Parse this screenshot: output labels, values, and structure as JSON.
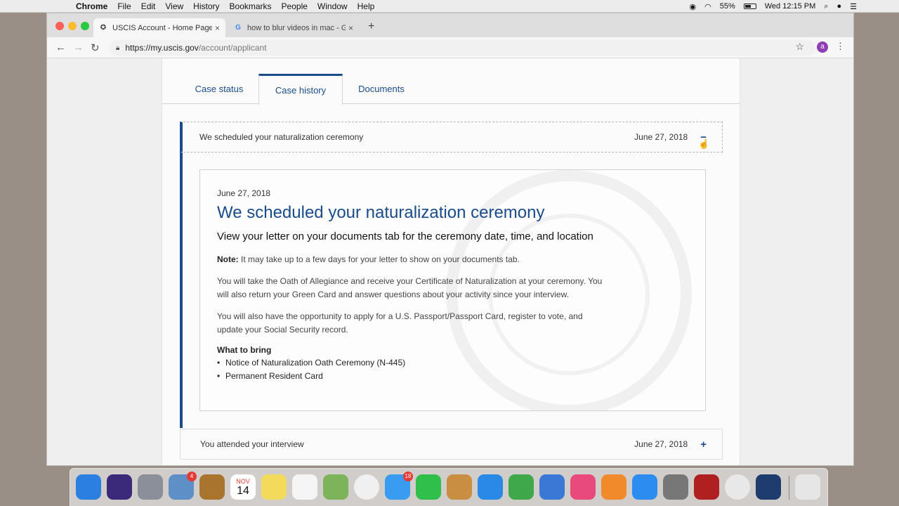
{
  "menubar": {
    "app_name": "Chrome",
    "items": [
      "File",
      "Edit",
      "View",
      "History",
      "Bookmarks",
      "People",
      "Window",
      "Help"
    ],
    "battery": "55%",
    "clock": "Wed 12:15 PM"
  },
  "browser": {
    "tabs": [
      {
        "title": "USCIS Account - Home Page",
        "close": "×"
      },
      {
        "title": "how to blur videos in mac - Go",
        "close": "×"
      }
    ],
    "new_tab": "+",
    "url_host": "https://my.uscis.gov",
    "url_path": "/account/applicant",
    "avatar": "a"
  },
  "page": {
    "tabs": [
      "Case status",
      "Case history",
      "Documents"
    ],
    "active_tab": "Case history",
    "history": [
      {
        "title": "We scheduled your naturalization ceremony",
        "date": "June 27, 2018",
        "toggle": "−",
        "expanded": true
      },
      {
        "title": "You attended your interview",
        "date": "June 27, 2018",
        "toggle": "+",
        "expanded": false
      }
    ],
    "detail": {
      "date": "June 27, 2018",
      "heading": "We scheduled your naturalization ceremony",
      "subheading": "View your letter on your documents tab for the ceremony date, time, and location",
      "note_label": "Note:",
      "note_text": " It may take up to a few days for your letter to show on your documents tab.",
      "paragraph_1": "You will take the Oath of Allegiance and receive your Certificate of Naturalization at your ceremony. You will also return your Green Card and answer questions about your activity since your interview.",
      "paragraph_2": "You will also have the opportunity to apply for a U.S. Passport/Passport Card, register to vote, and update your Social Security record.",
      "bring_title": "What to bring",
      "bring_items": [
        "Notice of Naturalization Oath Ceremony (N-445)",
        "Permanent Resident Card"
      ]
    }
  },
  "dock": {
    "icons": [
      {
        "name": "finder",
        "color": "#2b7fe0"
      },
      {
        "name": "siri",
        "color": "#3b2a7a"
      },
      {
        "name": "launchpad",
        "color": "#8a8f99"
      },
      {
        "name": "mail",
        "color": "#5f8fc7",
        "badge": "4"
      },
      {
        "name": "contacts",
        "color": "#a8742e"
      },
      {
        "name": "calendar",
        "color": "#ffffff",
        "label_month": "NOV",
        "label_day": "14"
      },
      {
        "name": "notes",
        "color": "#f4da5a"
      },
      {
        "name": "reminders",
        "color": "#f5f5f5"
      },
      {
        "name": "maps",
        "color": "#7db35b"
      },
      {
        "name": "photos",
        "color": "#f0f0f0"
      },
      {
        "name": "messages",
        "color": "#3a9cf0",
        "badge": "18"
      },
      {
        "name": "facetime",
        "color": "#2fbf4a"
      },
      {
        "name": "preview",
        "color": "#c98e42"
      },
      {
        "name": "safari",
        "color": "#2a88e6"
      },
      {
        "name": "numbers",
        "color": "#3fa84a"
      },
      {
        "name": "keynote",
        "color": "#3b78d6"
      },
      {
        "name": "itunes",
        "color": "#e84a7d"
      },
      {
        "name": "ibooks",
        "color": "#f08a2a"
      },
      {
        "name": "app-store",
        "color": "#2d8cf0"
      },
      {
        "name": "system-preferences",
        "color": "#777777"
      },
      {
        "name": "photo-booth",
        "color": "#b02020"
      },
      {
        "name": "chrome",
        "color": "#e8e8e8"
      },
      {
        "name": "quicktime",
        "color": "#1e3c6e"
      },
      {
        "name": "trash",
        "color": "#e6e6e6"
      }
    ]
  }
}
